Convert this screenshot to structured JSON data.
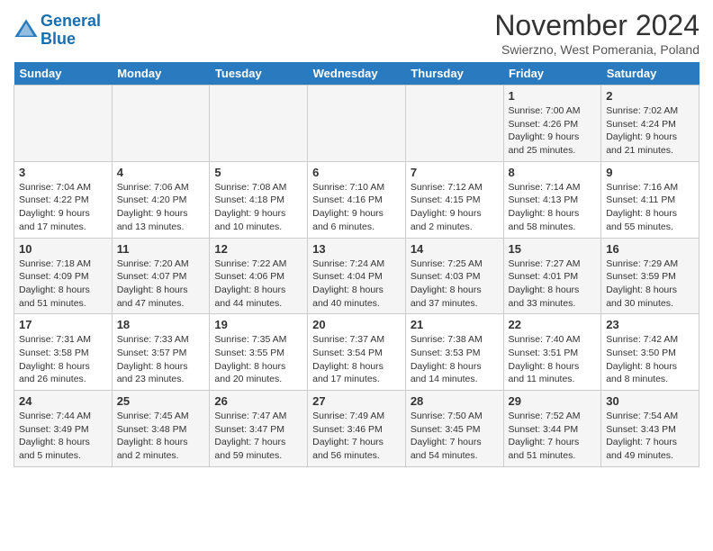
{
  "header": {
    "logo_line1": "General",
    "logo_line2": "Blue",
    "month_title": "November 2024",
    "subtitle": "Swierzno, West Pomerania, Poland"
  },
  "weekdays": [
    "Sunday",
    "Monday",
    "Tuesday",
    "Wednesday",
    "Thursday",
    "Friday",
    "Saturday"
  ],
  "weeks": [
    [
      {
        "day": "",
        "info": ""
      },
      {
        "day": "",
        "info": ""
      },
      {
        "day": "",
        "info": ""
      },
      {
        "day": "",
        "info": ""
      },
      {
        "day": "",
        "info": ""
      },
      {
        "day": "1",
        "info": "Sunrise: 7:00 AM\nSunset: 4:26 PM\nDaylight: 9 hours and 25 minutes."
      },
      {
        "day": "2",
        "info": "Sunrise: 7:02 AM\nSunset: 4:24 PM\nDaylight: 9 hours and 21 minutes."
      }
    ],
    [
      {
        "day": "3",
        "info": "Sunrise: 7:04 AM\nSunset: 4:22 PM\nDaylight: 9 hours and 17 minutes."
      },
      {
        "day": "4",
        "info": "Sunrise: 7:06 AM\nSunset: 4:20 PM\nDaylight: 9 hours and 13 minutes."
      },
      {
        "day": "5",
        "info": "Sunrise: 7:08 AM\nSunset: 4:18 PM\nDaylight: 9 hours and 10 minutes."
      },
      {
        "day": "6",
        "info": "Sunrise: 7:10 AM\nSunset: 4:16 PM\nDaylight: 9 hours and 6 minutes."
      },
      {
        "day": "7",
        "info": "Sunrise: 7:12 AM\nSunset: 4:15 PM\nDaylight: 9 hours and 2 minutes."
      },
      {
        "day": "8",
        "info": "Sunrise: 7:14 AM\nSunset: 4:13 PM\nDaylight: 8 hours and 58 minutes."
      },
      {
        "day": "9",
        "info": "Sunrise: 7:16 AM\nSunset: 4:11 PM\nDaylight: 8 hours and 55 minutes."
      }
    ],
    [
      {
        "day": "10",
        "info": "Sunrise: 7:18 AM\nSunset: 4:09 PM\nDaylight: 8 hours and 51 minutes."
      },
      {
        "day": "11",
        "info": "Sunrise: 7:20 AM\nSunset: 4:07 PM\nDaylight: 8 hours and 47 minutes."
      },
      {
        "day": "12",
        "info": "Sunrise: 7:22 AM\nSunset: 4:06 PM\nDaylight: 8 hours and 44 minutes."
      },
      {
        "day": "13",
        "info": "Sunrise: 7:24 AM\nSunset: 4:04 PM\nDaylight: 8 hours and 40 minutes."
      },
      {
        "day": "14",
        "info": "Sunrise: 7:25 AM\nSunset: 4:03 PM\nDaylight: 8 hours and 37 minutes."
      },
      {
        "day": "15",
        "info": "Sunrise: 7:27 AM\nSunset: 4:01 PM\nDaylight: 8 hours and 33 minutes."
      },
      {
        "day": "16",
        "info": "Sunrise: 7:29 AM\nSunset: 3:59 PM\nDaylight: 8 hours and 30 minutes."
      }
    ],
    [
      {
        "day": "17",
        "info": "Sunrise: 7:31 AM\nSunset: 3:58 PM\nDaylight: 8 hours and 26 minutes."
      },
      {
        "day": "18",
        "info": "Sunrise: 7:33 AM\nSunset: 3:57 PM\nDaylight: 8 hours and 23 minutes."
      },
      {
        "day": "19",
        "info": "Sunrise: 7:35 AM\nSunset: 3:55 PM\nDaylight: 8 hours and 20 minutes."
      },
      {
        "day": "20",
        "info": "Sunrise: 7:37 AM\nSunset: 3:54 PM\nDaylight: 8 hours and 17 minutes."
      },
      {
        "day": "21",
        "info": "Sunrise: 7:38 AM\nSunset: 3:53 PM\nDaylight: 8 hours and 14 minutes."
      },
      {
        "day": "22",
        "info": "Sunrise: 7:40 AM\nSunset: 3:51 PM\nDaylight: 8 hours and 11 minutes."
      },
      {
        "day": "23",
        "info": "Sunrise: 7:42 AM\nSunset: 3:50 PM\nDaylight: 8 hours and 8 minutes."
      }
    ],
    [
      {
        "day": "24",
        "info": "Sunrise: 7:44 AM\nSunset: 3:49 PM\nDaylight: 8 hours and 5 minutes."
      },
      {
        "day": "25",
        "info": "Sunrise: 7:45 AM\nSunset: 3:48 PM\nDaylight: 8 hours and 2 minutes."
      },
      {
        "day": "26",
        "info": "Sunrise: 7:47 AM\nSunset: 3:47 PM\nDaylight: 7 hours and 59 minutes."
      },
      {
        "day": "27",
        "info": "Sunrise: 7:49 AM\nSunset: 3:46 PM\nDaylight: 7 hours and 56 minutes."
      },
      {
        "day": "28",
        "info": "Sunrise: 7:50 AM\nSunset: 3:45 PM\nDaylight: 7 hours and 54 minutes."
      },
      {
        "day": "29",
        "info": "Sunrise: 7:52 AM\nSunset: 3:44 PM\nDaylight: 7 hours and 51 minutes."
      },
      {
        "day": "30",
        "info": "Sunrise: 7:54 AM\nSunset: 3:43 PM\nDaylight: 7 hours and 49 minutes."
      }
    ]
  ]
}
